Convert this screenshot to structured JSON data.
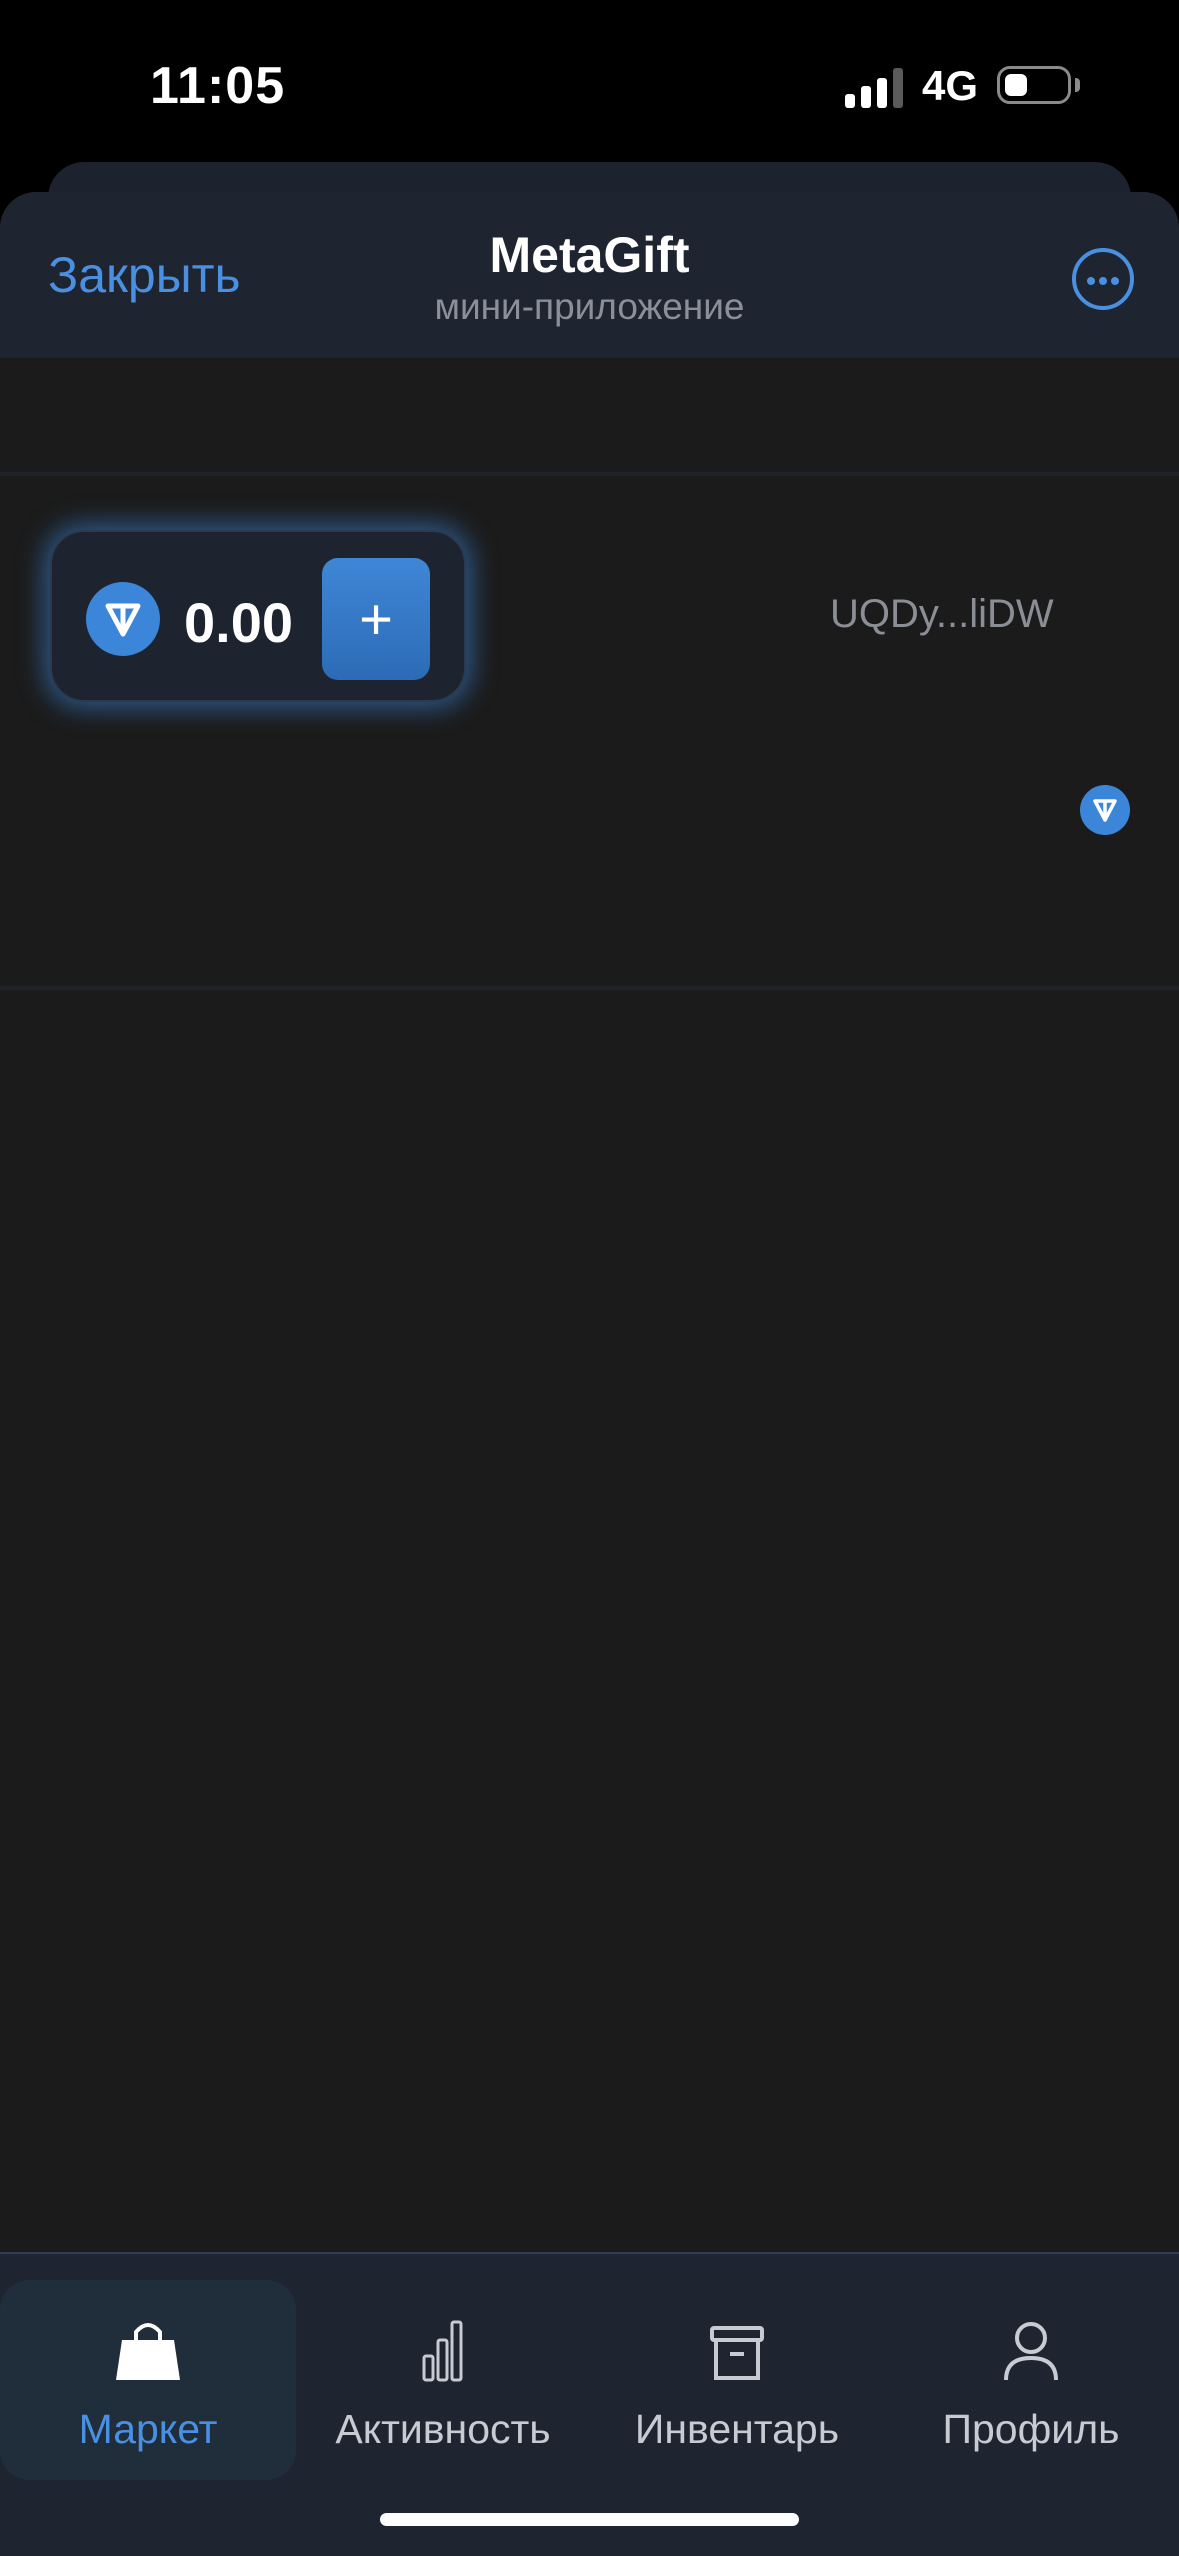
{
  "status_bar": {
    "time": "11:05",
    "network": "4G",
    "signal_bars_active": 3,
    "battery_level": 0.2
  },
  "header": {
    "close_label": "Закрыть",
    "title": "MetaGift",
    "subtitle": "мини-приложение",
    "menu_icon": "more-icon"
  },
  "balance": {
    "value": "0.00",
    "currency_icon": "ton-icon",
    "add_label": "+"
  },
  "wallet": {
    "address": "UQDy...liDW",
    "icon": "ton-icon"
  },
  "bottom_nav": {
    "items": [
      {
        "label": "Маркет",
        "icon": "shopping-bag-icon",
        "active": true
      },
      {
        "label": "Активность",
        "icon": "bar-chart-icon",
        "active": false
      },
      {
        "label": "Инвентарь",
        "icon": "archive-box-icon",
        "active": false
      },
      {
        "label": "Профиль",
        "icon": "user-icon",
        "active": false
      }
    ]
  },
  "colors": {
    "accent": "#4a90e2",
    "background": "#1b1b1b",
    "header_bg": "#1e2530",
    "ton_blue": "#3b86d8"
  }
}
